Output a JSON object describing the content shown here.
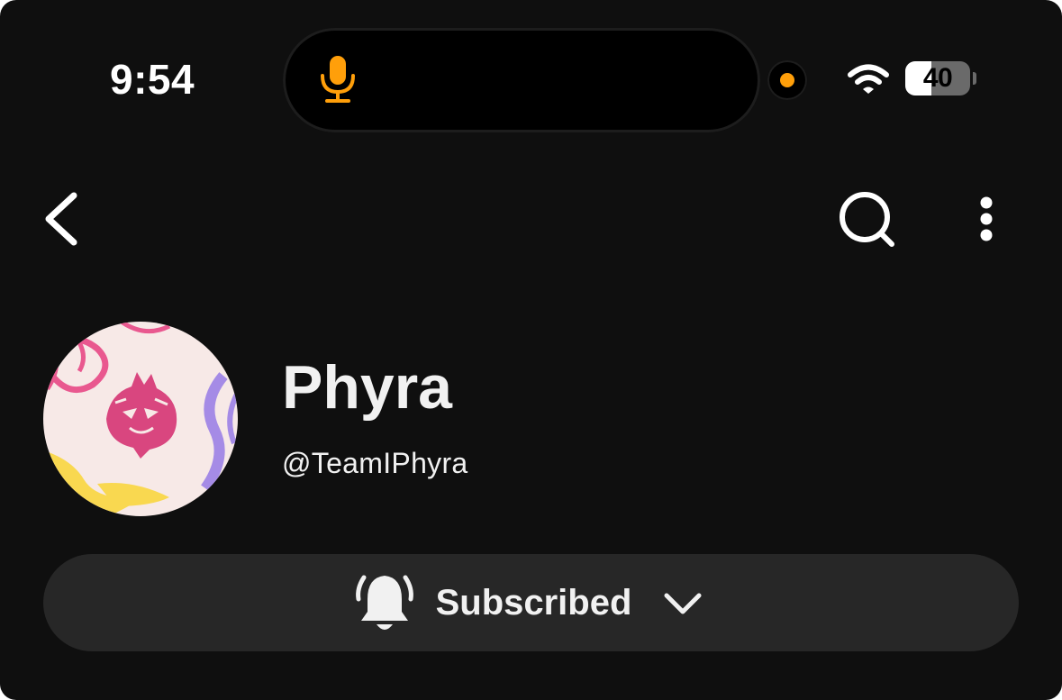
{
  "status_bar": {
    "time": "9:54",
    "battery_level": "40",
    "battery_fraction": 0.4,
    "recording_indicator_color": "#ff9f0a",
    "mic_icon_color": "#ff9f0a",
    "icons": [
      "microphone-icon",
      "wifi-icon",
      "battery-icon"
    ]
  },
  "top_bar": {
    "icons": [
      "back-arrow-icon",
      "search-icon",
      "more-vertical-icon"
    ]
  },
  "channel": {
    "name": "Phyra",
    "handle": "@TeamIPhyra",
    "avatar_colors": {
      "background": "#f7e9e7",
      "mark": "#d9467f",
      "accent_pink": "#e9588f",
      "accent_purple": "#a58be6",
      "accent_yellow": "#f9d850"
    }
  },
  "subscribe": {
    "label": "Subscribed",
    "icons": [
      "bell-ringing-icon",
      "chevron-down-icon"
    ]
  },
  "colors": {
    "background": "#0f0f0f",
    "button_background": "#272727",
    "text": "#f1f1f1"
  }
}
